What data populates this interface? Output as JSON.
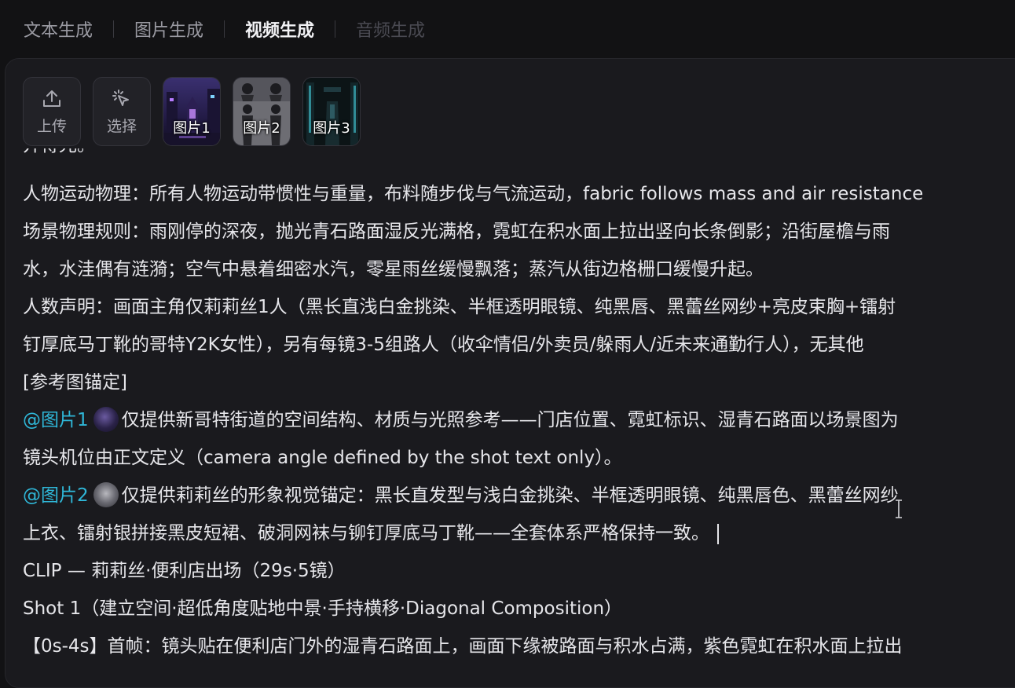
{
  "tabs": [
    {
      "label": "文本生成",
      "state": "normal"
    },
    {
      "label": "图片生成",
      "state": "normal"
    },
    {
      "label": "视频生成",
      "state": "active"
    },
    {
      "label": "音频生成",
      "state": "disabled"
    }
  ],
  "toolbar": {
    "upload_label": "上传",
    "select_label": "选择",
    "images": [
      {
        "label": "图片1"
      },
      {
        "label": "图片2"
      },
      {
        "label": "图片3"
      }
    ]
  },
  "editor": {
    "lines": {
      "l0": "并得光。",
      "l1": "人物运动物理：所有人物运动带惯性与重量，布料随步伐与气流运动，fabric follows mass and air resistance",
      "l2": "场景物理规则：雨刚停的深夜，抛光青石路面湿反光满格，霓虹在积水面上拉出竖向长条倒影；沿街屋檐与雨",
      "l3": "水，水洼偶有涟漪；空气中悬着细密水汽，零星雨丝缓慢飘落；蒸汽从街边格栅口缓慢升起。",
      "l4": "人数声明：画面主角仅莉莉丝1人（黑长直浅白金挑染、半框透明眼镜、纯黑唇、黑蕾丝网纱+亮皮束胸+镭射",
      "l5": "钉厚底马丁靴的哥特Y2K女性），另有每镜3-5组路人（收伞情侣/外卖员/躲雨人/近未来通勤行人），无其他",
      "l6": "[参考图锚定]",
      "l7_mention": "@图片1",
      "l7_text": "仅提供新哥特街道的空间结构、材质与光照参考——门店位置、霓虹标识、湿青石路面以场景图为",
      "l8": "镜头机位由正文定义（camera angle defined by the shot text only）。",
      "l9_mention": "@图片2",
      "l9_text": "仅提供莉莉丝的形象视觉锚定：黑长直发型与浅白金挑染、半框透明眼镜、纯黑唇色、黑蕾丝网纱",
      "l10": "上衣、镭射银拼接黑皮短裙、破洞网袜与铆钉厚底马丁靴——全套体系严格保持一致。",
      "l11": "CLIP — 莉莉丝·便利店出场（29s·5镜）",
      "l12": "Shot 1（建立空间·超低角度贴地中景·手持横移·Diagonal Composition）",
      "l13": "【0s-4s】首帧：镜头贴在便利店门外的湿青石路面上，画面下缘被路面与积水占满，紫色霓虹在积水面上拉出"
    }
  },
  "colors": {
    "background": "#121214",
    "panel": "#1a1a1e",
    "mention": "#2fb7d8",
    "text": "#e6e6ea"
  }
}
